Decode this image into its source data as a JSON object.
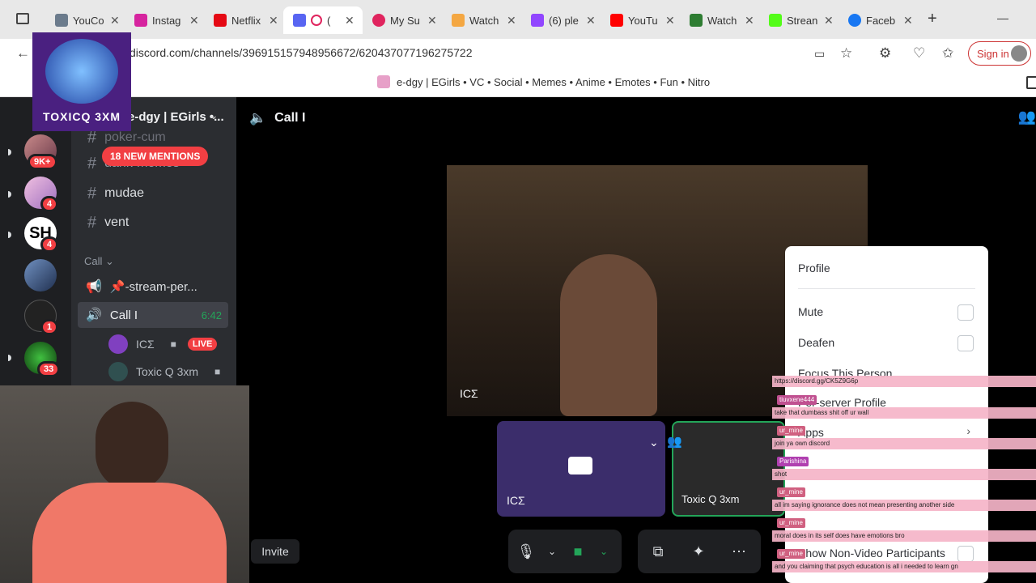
{
  "browser": {
    "tabs": [
      {
        "title": "YouCo",
        "favicon_color": "#6b7b8c"
      },
      {
        "title": "Instag",
        "favicon_color": "#d6249f"
      },
      {
        "title": "Netflix",
        "favicon_color": "#e50914"
      },
      {
        "title": "(",
        "favicon_color": "#5865f2",
        "active": true
      },
      {
        "title": "My Su",
        "favicon_color": "#e0245e"
      },
      {
        "title": "Watch",
        "favicon_color": "#f4a742"
      },
      {
        "title": "(6) ple",
        "favicon_color": "#9146ff"
      },
      {
        "title": "YouTu",
        "favicon_color": "#ff0000"
      },
      {
        "title": "Watch",
        "favicon_color": "#2e7d32"
      },
      {
        "title": "Strean",
        "favicon_color": "#53fc18"
      },
      {
        "title": "Faceb",
        "favicon_color": "#1877f2"
      }
    ],
    "new_tab_symbol": "+",
    "minimize_symbol": "—",
    "url": "discord.com/channels/396915157948956672/620437077196275722",
    "sign_in_label": "Sign in",
    "favorite_label": "e-dgy | EGirls • VC • Social • Memes • Anime • Emotes • Fun • Nitro"
  },
  "logo": {
    "text": "TOXICQ 3XM"
  },
  "guilds": {
    "badges": [
      "9K+",
      "4",
      "4",
      "1",
      "33"
    ],
    "server_label": "SH"
  },
  "server": {
    "name": "e-dgy | EGirls •...",
    "mention_pill": "18 NEW MENTIONS",
    "channels": [
      "poker-cum",
      "dank-memes",
      "mudae",
      "vent"
    ],
    "category": "Call",
    "voice_channels": [
      {
        "name": "📌-stream-per...",
        "selected": false
      },
      {
        "name": "Call I",
        "selected": true,
        "time": "6:42"
      }
    ],
    "voice_users": [
      {
        "name": "ICΣ",
        "live": "LIVE"
      },
      {
        "name": "Toxic Q 3xm"
      }
    ]
  },
  "stage": {
    "title": "Call I",
    "main_video_name": "ICΣ",
    "tiles": [
      {
        "name": "ICΣ"
      },
      {
        "name": "Toxic Q 3xm"
      }
    ],
    "invite_label": "Invite"
  },
  "context_menu": {
    "items": [
      "Profile",
      "Mute",
      "Deafen",
      "Focus This Person",
      "Per-server Profile",
      "Apps",
      "Show Non-Video Participants"
    ]
  },
  "chat": [
    {
      "text": "https://discord.gg/CK5Z9G6p"
    },
    {
      "user": "tiuvxene444",
      "text": "take that dumbass shit off ur wall"
    },
    {
      "user": "ur_mine",
      "text": "join ya own discord"
    },
    {
      "user": "Parishina",
      "text": "shot"
    },
    {
      "user": "ur_mine",
      "text": "all im saying ignorance does not mean presenting another side"
    },
    {
      "user": "ur_mine",
      "text": "moral does in its self does have emotions bro"
    },
    {
      "user": "ur_mine",
      "text": "and you claiming that psych education is all i needed to learn gn"
    }
  ]
}
